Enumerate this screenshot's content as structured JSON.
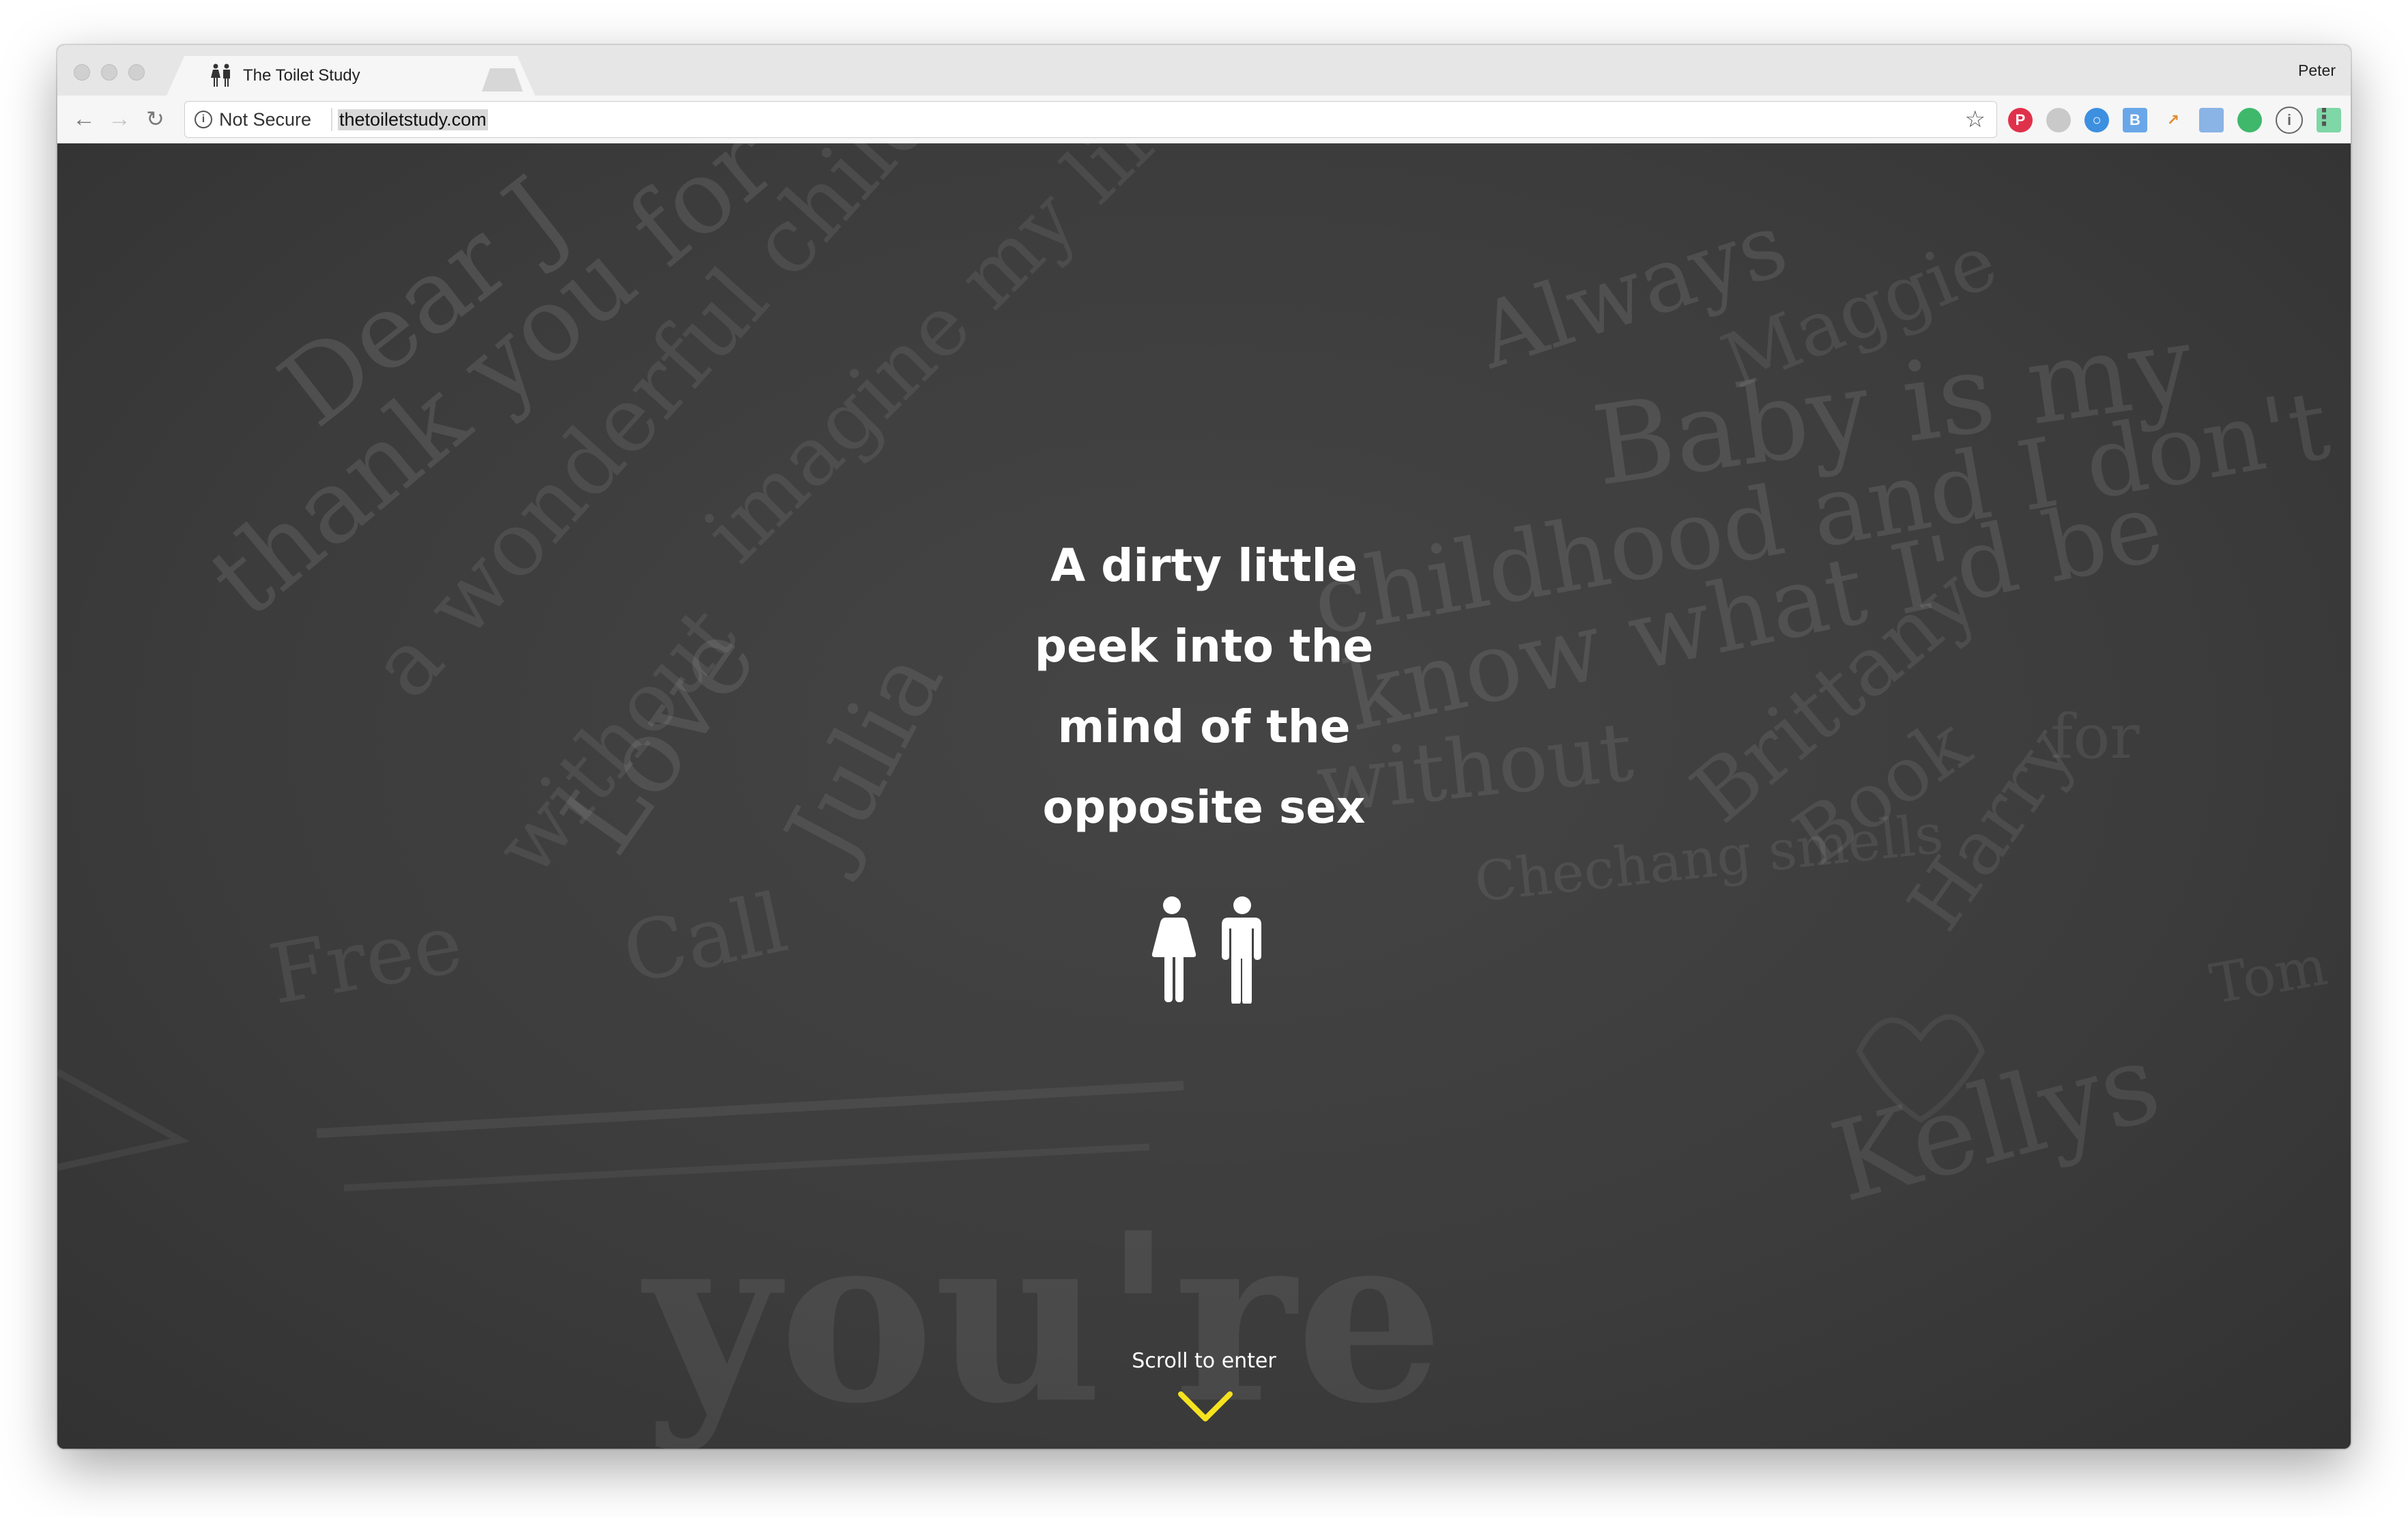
{
  "browser": {
    "tab_title": "The Toilet Study",
    "tab_close": "×",
    "profile_name": "Peter",
    "security_label": "Not Secure",
    "url": "thetoiletstudy.com"
  },
  "page": {
    "headline_lines": [
      "A dirty little",
      "peek into the",
      "mind of the",
      "opposite sex"
    ],
    "scroll_hint": "Scroll to enter",
    "graffiti": [
      "Dear J",
      "thank you for",
      "a wonderful childhood",
      "Love",
      "Julia",
      "imagine my life",
      "without",
      "Always",
      "Maggie",
      "Baby is my",
      "childhood and I don't",
      "know what I'd be",
      "without",
      "Brittany",
      "Book",
      "Harry",
      "Free",
      "Call",
      "Kellys",
      "you're",
      "Chechang smells",
      "for",
      "Tom"
    ]
  },
  "colors": {
    "page_bg": "#3d3d3d",
    "text": "#ffffff",
    "accent_chevron": "#f5e21f"
  },
  "icons": [
    "restroom-icon",
    "chevron-down-icon",
    "star-icon",
    "info-icon"
  ]
}
